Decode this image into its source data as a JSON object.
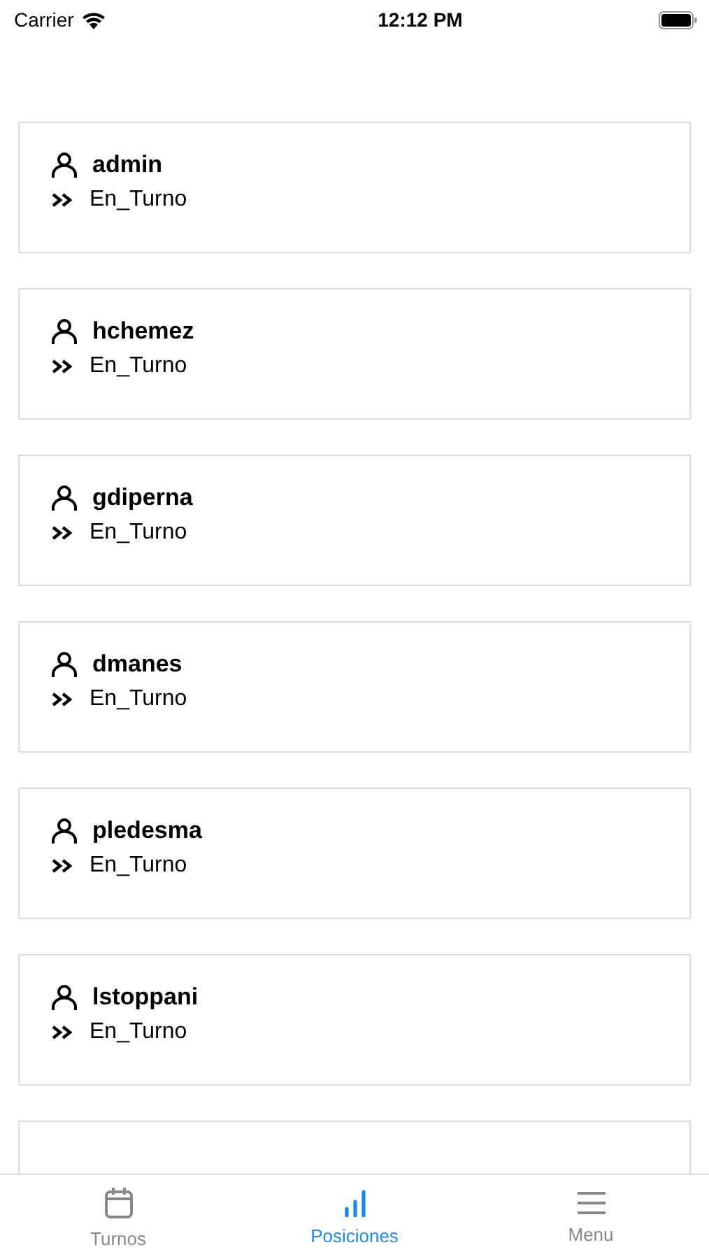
{
  "status_bar": {
    "carrier": "Carrier",
    "time": "12:12 PM"
  },
  "users": [
    {
      "name": "admin",
      "status": "En_Turno"
    },
    {
      "name": "hchemez",
      "status": "En_Turno"
    },
    {
      "name": "gdiperna",
      "status": "En_Turno"
    },
    {
      "name": "dmanes",
      "status": "En_Turno"
    },
    {
      "name": "pledesma",
      "status": "En_Turno"
    },
    {
      "name": "lstoppani",
      "status": "En_Turno"
    }
  ],
  "tabs": [
    {
      "label": "Turnos",
      "kind": "calendar",
      "selected": false
    },
    {
      "label": "Posiciones",
      "kind": "chart",
      "selected": true
    },
    {
      "label": "Menu",
      "kind": "menu",
      "selected": false
    }
  ]
}
